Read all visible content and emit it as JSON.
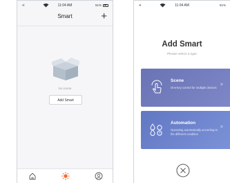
{
  "list_screen": {
    "status": {
      "time": "11:04 AM",
      "battery": "51%"
    },
    "title": "Smart",
    "plus_icon": "+",
    "empty_text": "No scene",
    "add_button": "Add Smart",
    "tabs": [
      {
        "icon": "home-icon",
        "active": false
      },
      {
        "icon": "smart-sun-icon",
        "active": true
      },
      {
        "icon": "profile-icon",
        "active": false
      }
    ]
  },
  "add_screen": {
    "status": {
      "time": "11:04 AM",
      "battery": "51%"
    },
    "title": "Add Smart",
    "subtitle": "Please select a type",
    "cards": [
      {
        "title": "Scene",
        "description": "One-key control for multiple devices",
        "icon": "touch-hand-icon"
      },
      {
        "title": "Automation",
        "description": "Operating automatically according to the different condition",
        "icon": "automation-icon"
      }
    ],
    "close_icon": "×"
  },
  "colors": {
    "accent": "#f06a2b",
    "scene_card": "#7079bd",
    "automation_card": "#6b83cf"
  }
}
